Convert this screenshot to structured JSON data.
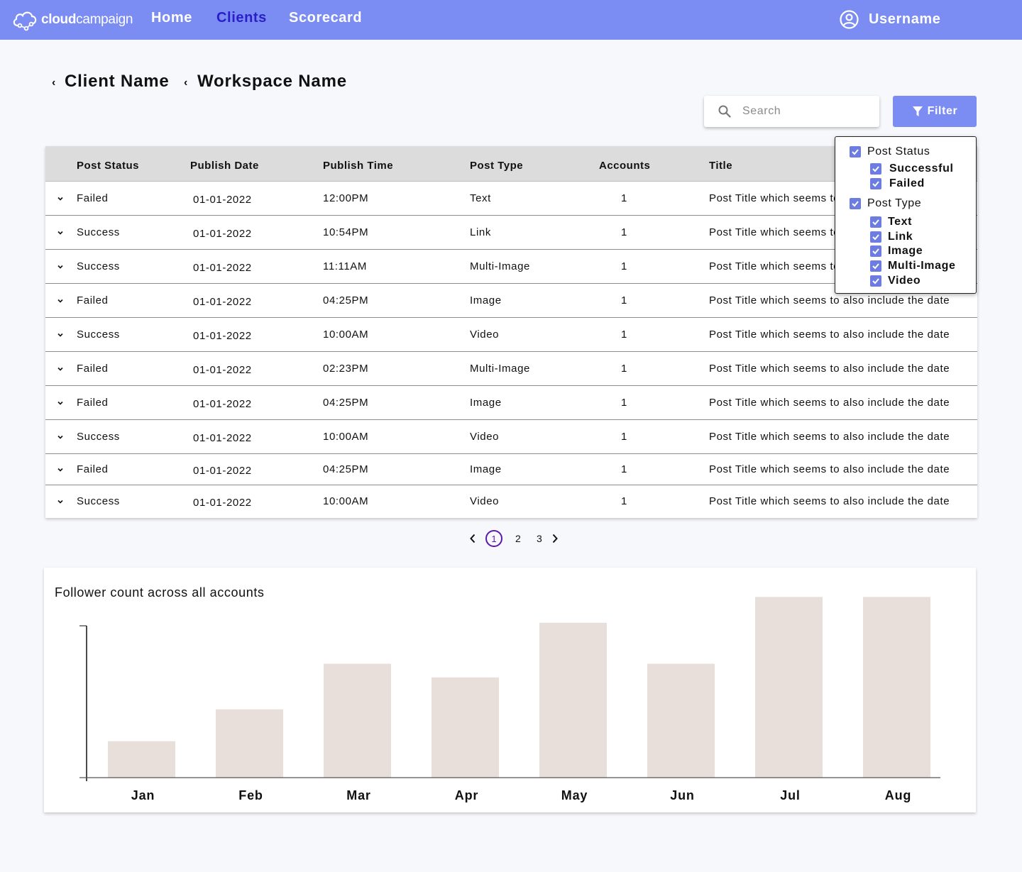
{
  "nav": {
    "logo_bold": "cloud",
    "logo_light": "campaign",
    "links": [
      "Home",
      "Clients",
      "Scorecard"
    ],
    "active_link": "Clients",
    "username": "Username",
    "user_icon": "user-circle-icon",
    "bg_color": "#7b8cf2",
    "active_color": "#2a1fc7"
  },
  "breadcrumb": {
    "client": "Client Name",
    "workspace": "Workspace Name"
  },
  "search": {
    "placeholder": "Search",
    "value": ""
  },
  "filter_button": {
    "label": "Filter",
    "icon": "funnel-icon"
  },
  "table": {
    "columns": [
      "Post Status",
      "Publish Date",
      "Publish Time",
      "Post Type",
      "Accounts",
      "Title"
    ],
    "rows": [
      {
        "status": "Failed",
        "date": "01-01-2022",
        "time": "12:00PM",
        "type": "Text",
        "accounts": "1",
        "title": "Post Title which seems to also include the date"
      },
      {
        "status": "Success",
        "date": "01-01-2022",
        "time": "10:54PM",
        "type": "Link",
        "accounts": "1",
        "title": "Post Title which seems to also include the date"
      },
      {
        "status": "Success",
        "date": "01-01-2022",
        "time": "11:11AM",
        "type": "Multi-Image",
        "accounts": "1",
        "title": "Post Title which seems to also include the date"
      },
      {
        "status": "Failed",
        "date": "01-01-2022",
        "time": "04:25PM",
        "type": "Image",
        "accounts": "1",
        "title": "Post Title which seems to also include the date"
      },
      {
        "status": "Success",
        "date": "01-01-2022",
        "time": "10:00AM",
        "type": "Video",
        "accounts": "1",
        "title": "Post Title which seems to also include the date"
      },
      {
        "status": "Failed",
        "date": "01-01-2022",
        "time": "02:23PM",
        "type": "Multi-Image",
        "accounts": "1",
        "title": "Post Title which seems to also include the date"
      },
      {
        "status": "Failed",
        "date": "01-01-2022",
        "time": "04:25PM",
        "type": "Image",
        "accounts": "1",
        "title": "Post Title which seems to also include the date"
      },
      {
        "status": "Success",
        "date": "01-01-2022",
        "time": "10:00AM",
        "type": "Video",
        "accounts": "1",
        "title": "Post Title which seems to also include the date"
      },
      {
        "status": "Failed",
        "date": "01-01-2022",
        "time": "04:25PM",
        "type": "Image",
        "accounts": "1",
        "title": "Post Title which seems to also include the date"
      },
      {
        "status": "Success",
        "date": "01-01-2022",
        "time": "10:00AM",
        "type": "Video",
        "accounts": "1",
        "title": "Post Title which seems to also include the date"
      }
    ]
  },
  "filter_menu": {
    "groups": [
      {
        "label": "Post Status",
        "checked": true,
        "options": [
          {
            "label": "Successful",
            "checked": true
          },
          {
            "label": "Failed",
            "checked": true
          }
        ]
      },
      {
        "label": "Post Type",
        "checked": true,
        "options": [
          {
            "label": "Text",
            "checked": true
          },
          {
            "label": "Link",
            "checked": true
          },
          {
            "label": "Image",
            "checked": true
          },
          {
            "label": "Multi-Image",
            "checked": true
          },
          {
            "label": "Video",
            "checked": true
          }
        ]
      }
    ],
    "checkbox_color": "#6c7ce0"
  },
  "pagination": {
    "pages": [
      "1",
      "2",
      "3"
    ],
    "current": "1"
  },
  "chart_data": {
    "type": "bar",
    "title": "Follower count across all accounts",
    "categories": [
      "Jan",
      "Feb",
      "Mar",
      "Apr",
      "May",
      "Jun",
      "Jul",
      "Aug"
    ],
    "values": [
      24,
      45,
      75,
      66,
      102,
      75,
      119,
      119
    ],
    "ylim": [
      0,
      100
    ],
    "bar_color": "#e8deda",
    "xlabel": "",
    "ylabel": "",
    "grid": false
  }
}
